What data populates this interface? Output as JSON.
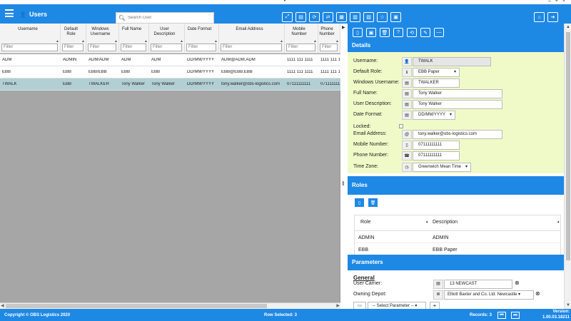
{
  "window": {
    "collapse_arrow": "▼",
    "controls": "– + ×"
  },
  "header": {
    "title": "Users",
    "users_icon": "👤",
    "search_placeholder": "Search User",
    "search_icon": "search-icon"
  },
  "toolbar": [
    {
      "name": "expand-button",
      "glyph": "⤢"
    },
    {
      "name": "database-button",
      "glyph": "▤"
    },
    {
      "name": "refresh-button",
      "glyph": "⟳"
    },
    {
      "name": "share-button",
      "glyph": "⇄"
    },
    {
      "name": "grid-button",
      "glyph": "▦"
    },
    {
      "name": "report-button",
      "glyph": "▥"
    },
    {
      "name": "export-button",
      "glyph": "▧"
    },
    {
      "name": "favourite-button",
      "glyph": "☆"
    },
    {
      "name": "layout-button",
      "glyph": "▣"
    }
  ],
  "toolbar_right": [
    {
      "name": "home-button",
      "glyph": "⌂"
    },
    {
      "name": "logout-button",
      "glyph": "➜"
    }
  ],
  "grid": {
    "filter_placeholder": "Filter",
    "columns": [
      {
        "label": "Username",
        "w": 85
      },
      {
        "label": "Default Role",
        "w": 36
      },
      {
        "label": "Windows Username",
        "w": 46
      },
      {
        "label": "Full Name",
        "w": 42
      },
      {
        "label": "User Description",
        "w": 50
      },
      {
        "label": "Date Format",
        "w": 48
      },
      {
        "label": "Email Address",
        "w": 92
      },
      {
        "label": "Mobile Number",
        "w": 47
      },
      {
        "label": "Phone Number",
        "w": 31
      }
    ],
    "rows": [
      [
        "ADM",
        "ADMIN",
        "ADM/ADM",
        "ADM",
        "ADM",
        "DD/MM/YYYY",
        "ADM@ADM.ADM",
        "1111 111 1111",
        "1111 111 1"
      ],
      [
        "EBB",
        "EBB",
        "EBB/EBB",
        "EBB",
        "EBB",
        "DD/MM/YYYY",
        "EBB@EBB.EBB",
        "1111 111 1111",
        "1111 111 1"
      ],
      [
        "TWALK",
        "EBB",
        "TWALKER",
        "Tony Walker",
        "Tony Walker",
        "DD/MM/YYYY",
        "tony.walker@obs-logistics.com",
        "07111111111",
        "071111111"
      ]
    ],
    "selected_row": 2
  },
  "panel_tools": [
    {
      "name": "new-button",
      "glyph": "▯"
    },
    {
      "name": "save-button",
      "glyph": "▣"
    },
    {
      "name": "delete-button",
      "glyph": "🗑"
    },
    {
      "name": "help-button",
      "glyph": "?"
    },
    {
      "name": "undo-button",
      "glyph": "⟲"
    },
    {
      "name": "erase-button",
      "glyph": "✎"
    },
    {
      "name": "minimize-button",
      "glyph": "—"
    }
  ],
  "details": {
    "heading": "Details",
    "fields": [
      {
        "label": "Username:",
        "icon": "👤",
        "value": "TWALK",
        "readonly": true,
        "w": 110
      },
      {
        "label": "Default Role:",
        "icon": "ℹ",
        "value": "EBB Paper",
        "select": true,
        "w": 66
      },
      {
        "label": "Windows Username:",
        "icon": "▤",
        "value": "TWALKER",
        "w": 66
      },
      {
        "label": "Full Name:",
        "icon": "▤",
        "value": "Tony Walker",
        "w": 126
      },
      {
        "label": "User Description:",
        "icon": "▤",
        "value": "Tony Walker",
        "w": 126
      },
      {
        "label": "Date Format:",
        "icon": "▤",
        "value": "DD/MM/YYYY",
        "select": true,
        "w": 60
      },
      {
        "label": "Locked:",
        "icon": "",
        "value": "",
        "checkbox": true
      },
      {
        "label": "Email Address:",
        "icon": "@",
        "value": "tony.walker@obs-logistics.com",
        "w": 126
      },
      {
        "label": "Mobile Number:",
        "icon": "▯",
        "value": "07111111111",
        "w": 66
      },
      {
        "label": "Phone Number:",
        "icon": "☎",
        "value": "07111111111",
        "w": 66
      },
      {
        "label": "Time Zone:",
        "icon": "◷",
        "value": "Greenwich Mean Time",
        "select": true,
        "w": 82
      }
    ]
  },
  "roles": {
    "heading": "Roles",
    "columns": [
      "Role",
      "Description"
    ],
    "rows": [
      [
        "ADMIN",
        "ADMIN"
      ],
      [
        "EBB",
        "EBB Paper"
      ]
    ]
  },
  "parameters": {
    "heading": "Parameters",
    "group": "General",
    "user_carrier_label": "User Carrier:",
    "user_carrier_value": "13 NEWCAST",
    "owning_depot_label": "Owning Depot:",
    "owning_depot_value": "Elliott Baxter and Co. Ltd. Newcastle",
    "select_param": "-- Select Parameter --",
    "add": "+"
  },
  "status": {
    "copyright": "Copyright © OBS Logistics 2020",
    "row_selected": "Row Selected: 3",
    "records": "Records: 3",
    "version_label": "Version:",
    "version": "1.00.03.18211"
  },
  "colors": {
    "accent": "#1e88e5",
    "details_bg": "#f0fac8",
    "selected_row": "#b2cfd4"
  }
}
